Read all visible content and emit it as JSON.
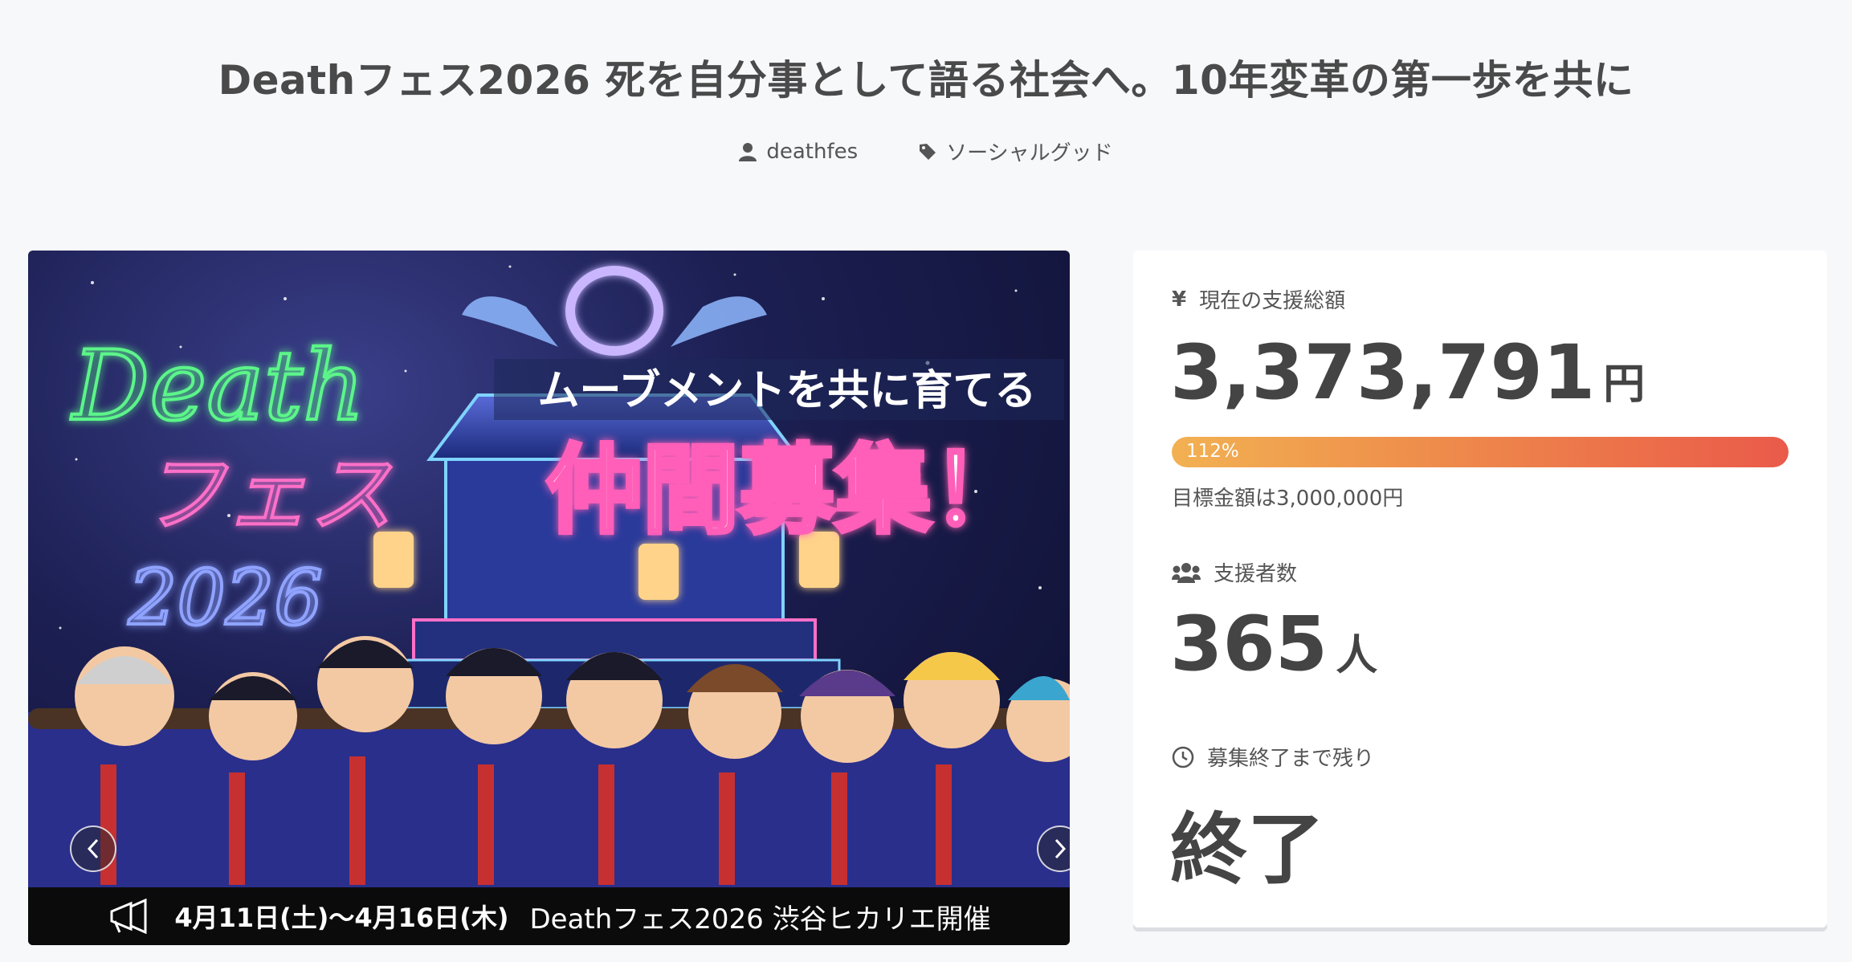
{
  "header": {
    "title": "Deathフェス2026 死を自分事として語る社会へ。10年変革の第一歩を共に",
    "author": "deathfes",
    "category": "ソーシャルグッド"
  },
  "hero": {
    "logo_line1": "Death",
    "logo_line2": "フェス",
    "logo_year": "2026",
    "headline_sub": "ムーブメントを共に育てる",
    "headline_main": "仲間募集！",
    "event_dates": "4月11日(土)〜4月16日(木)",
    "event_venue": "Deathフェス2026 渋谷ヒカリエ開催",
    "prev_icon": "chevron-left-icon",
    "next_icon": "chevron-right-icon"
  },
  "stats": {
    "amount_label": "現在の支援総額",
    "amount_value": "3,373,791",
    "amount_unit": "円",
    "progress_percent": 112,
    "progress_label": "112%",
    "goal_text": "目標金額は3,000,000円",
    "supporters_label": "支援者数",
    "supporters_value": "365",
    "supporters_unit": "人",
    "remaining_label": "募集終了まで残り",
    "remaining_value": "終了"
  },
  "colors": {
    "progress_start": "#f2b152",
    "progress_end": "#ea5a4a",
    "neon_green": "#5cf58a",
    "neon_pink": "#ff6fc8"
  }
}
